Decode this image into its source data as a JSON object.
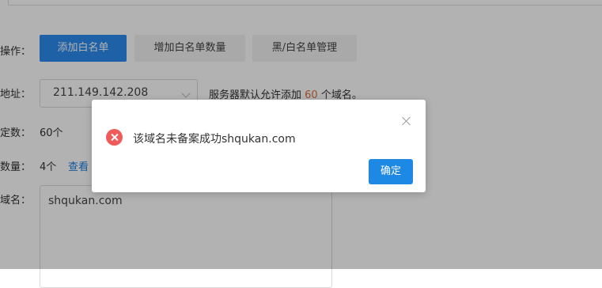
{
  "form": {
    "operation_label": "操作：",
    "ip_label": "地址：",
    "total_label": "定数：",
    "count_label": "数量：",
    "domain_label": "域名："
  },
  "buttons": {
    "add_whitelist": "添加白名单",
    "increase_count": "增加白名单数量",
    "manage_lists": "黑/白名单管理"
  },
  "ip_select": {
    "value": "211.149.142.208"
  },
  "hint": {
    "prefix": "服务器默认允许添加",
    "number": "60",
    "suffix": "个域名。"
  },
  "total_value": "60个",
  "count_value": "4个",
  "view_link": "查看",
  "domain_value": "shqukan.com",
  "dialog": {
    "message": "该域名未备案成功shqukan.com",
    "ok_label": "确定"
  }
}
